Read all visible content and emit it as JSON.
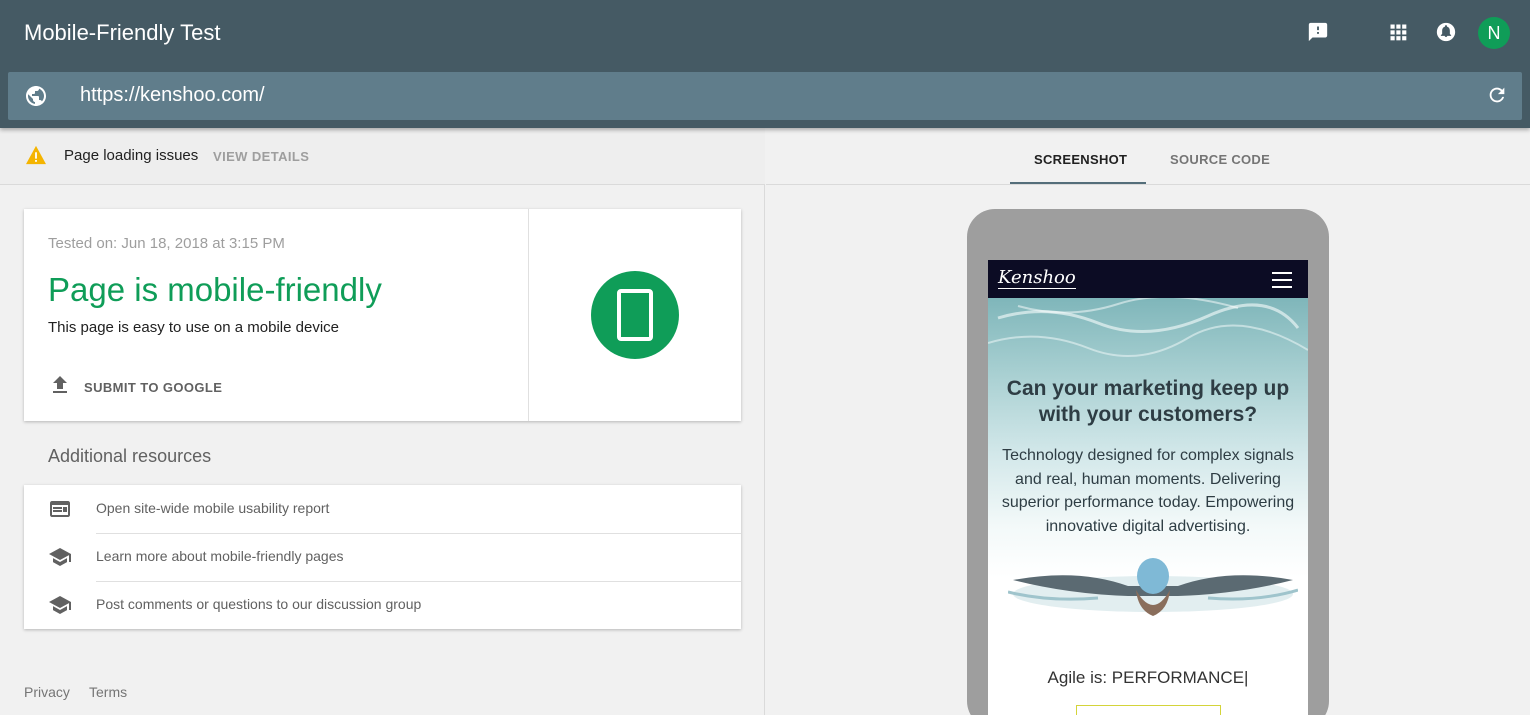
{
  "header": {
    "title": "Mobile-Friendly Test",
    "avatar_initial": "N",
    "url": "https://kenshoo.com/",
    "icons": [
      "feedback-icon",
      "apps-grid-icon",
      "notifications-icon",
      "globe-icon",
      "reload-icon"
    ]
  },
  "issues": {
    "text": "Page loading issues",
    "action": "VIEW DETAILS"
  },
  "result": {
    "tested_on": "Tested on: Jun 18, 2018 at 3:15 PM",
    "verdict": "Page is mobile-friendly",
    "subtitle": "This page is easy to use on a mobile device",
    "submit_label": "SUBMIT TO GOOGLE"
  },
  "resources": {
    "heading": "Additional resources",
    "items": [
      {
        "label": "Open site-wide mobile usability report",
        "icon": "report-icon"
      },
      {
        "label": "Learn more about mobile-friendly pages",
        "icon": "school-icon"
      },
      {
        "label": "Post comments or questions to our discussion group",
        "icon": "school-icon"
      }
    ]
  },
  "footer": {
    "privacy": "Privacy",
    "terms": "Terms"
  },
  "tabs": [
    {
      "label": "SCREENSHOT",
      "active": true
    },
    {
      "label": "SOURCE CODE",
      "active": false
    }
  ],
  "preview": {
    "logo": "Kenshoo",
    "heading": "Can your marketing keep up with your customers?",
    "copy": "Technology designed for complex signals and real, human moments. Delivering superior performance today. Empowering innovative digital advertising.",
    "agile": "Agile is: PERFORMANCE|"
  },
  "colors": {
    "appbar": "#455a64",
    "urlbar": "#607d8b",
    "success_green": "#0f9d58",
    "warning_amber": "#f4b400"
  }
}
